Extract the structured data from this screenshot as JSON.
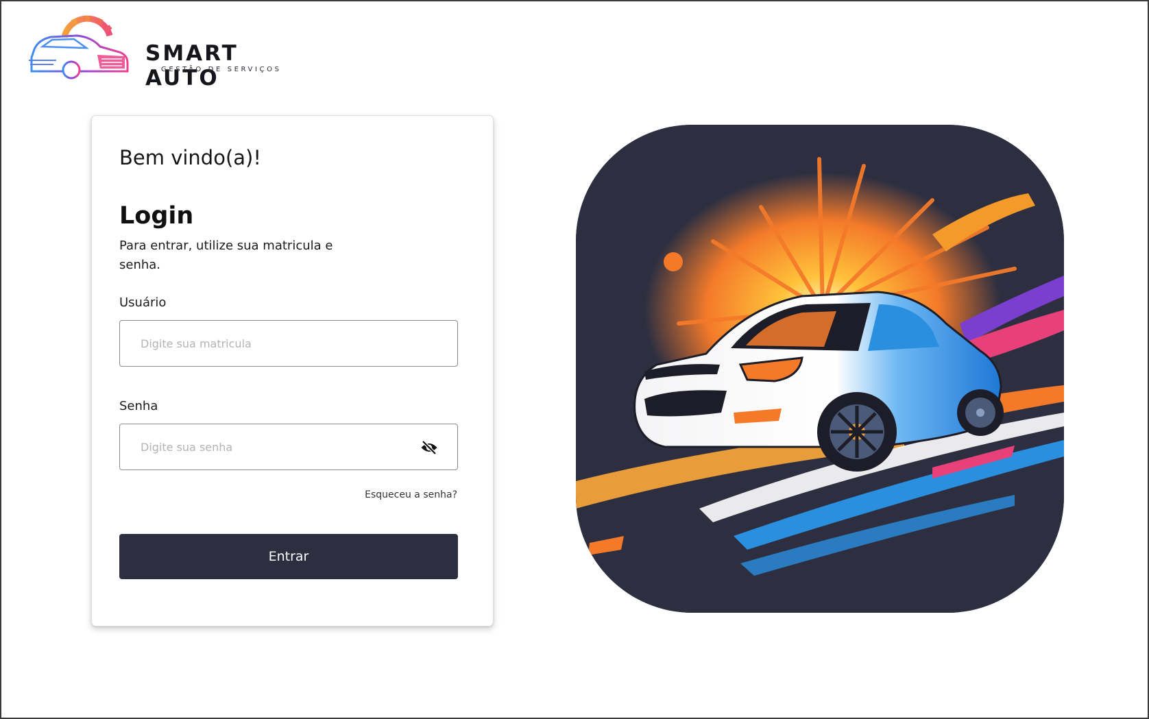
{
  "brand": {
    "name": "SMART AUTO",
    "tagline": "GESTÃO DE SERVIÇOS"
  },
  "card": {
    "greeting": "Bem vindo(a)!",
    "title": "Login",
    "description": "Para entrar, utilize sua matricula e senha."
  },
  "form": {
    "user_label": "Usuário",
    "user_placeholder": "Digite sua matricula",
    "password_label": "Senha",
    "password_placeholder": "Digite sua senha",
    "forgot_link": "Esqueceu a senha?",
    "submit_label": "Entrar"
  },
  "icons": {
    "logo": "car-gear-logo-icon",
    "password_toggle": "eye-off-icon",
    "hero": "sports-car-illustration"
  },
  "colors": {
    "primary": "#2d2f41",
    "hero_background": "#2d2f41",
    "accent_orange": "#f47a2a",
    "accent_blue": "#2b8fe0",
    "accent_pink": "#e8417a",
    "accent_purple": "#7b3fd0"
  }
}
